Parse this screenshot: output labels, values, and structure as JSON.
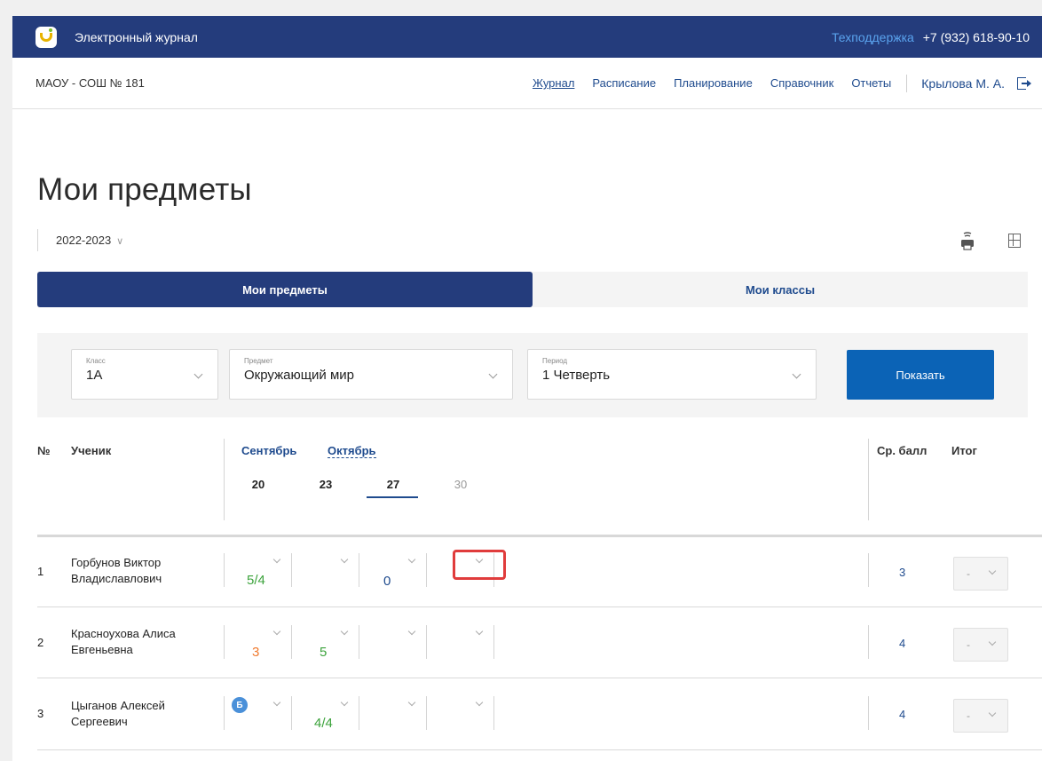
{
  "app": {
    "title": "Электронный журнал",
    "support_label": "Техподдержка",
    "support_phone": "+7 (932) 618-90-10"
  },
  "nav": {
    "school": "МАОУ - СОШ № 181",
    "items": [
      {
        "label": "Журнал",
        "active": true
      },
      {
        "label": "Расписание",
        "active": false
      },
      {
        "label": "Планирование",
        "active": false
      },
      {
        "label": "Справочник",
        "active": false
      },
      {
        "label": "Отчеты",
        "active": false
      }
    ],
    "user": "Крылова М. А."
  },
  "page": {
    "title": "Мои предметы",
    "year": "2022-2023"
  },
  "tabs": [
    {
      "label": "Мои предметы",
      "active": true
    },
    {
      "label": "Мои классы",
      "active": false
    }
  ],
  "filters": {
    "class": {
      "label": "Класс",
      "value": "1А"
    },
    "subject": {
      "label": "Предмет",
      "value": "Окружающий мир"
    },
    "period": {
      "label": "Период",
      "value": "1 Четверть"
    },
    "show_button": "Показать"
  },
  "table": {
    "headers": {
      "num": "№",
      "student": "Ученик",
      "avg": "Ср. балл",
      "final": "Итог"
    },
    "months": [
      "Сентябрь",
      "Октябрь"
    ],
    "days": [
      "20",
      "23",
      "27",
      "30"
    ],
    "selected_day": "27",
    "rows": [
      {
        "num": "1",
        "name_line1": "Горбунов Виктор",
        "name_line2": "Владиславлович",
        "marks": [
          "5/4",
          "",
          "0",
          ""
        ],
        "avg": "3",
        "final": "-"
      },
      {
        "num": "2",
        "name_line1": "Красноухова Алиса",
        "name_line2": "Евгеньевна",
        "marks": [
          "3",
          "5",
          "",
          ""
        ],
        "avg": "4",
        "final": "-"
      },
      {
        "num": "3",
        "name_line1": "Цыганов Алексей",
        "name_line2": "Сергеевич",
        "marks": [
          "",
          "4/4",
          "",
          ""
        ],
        "badge": "Б",
        "avg": "4",
        "final": "-"
      }
    ]
  },
  "colors": {
    "primary": "#243c7c",
    "accent": "#0b63b6",
    "grade_good": "#3ca33c",
    "grade_mid": "#f07a2e",
    "highlight": "#e03c3c"
  }
}
